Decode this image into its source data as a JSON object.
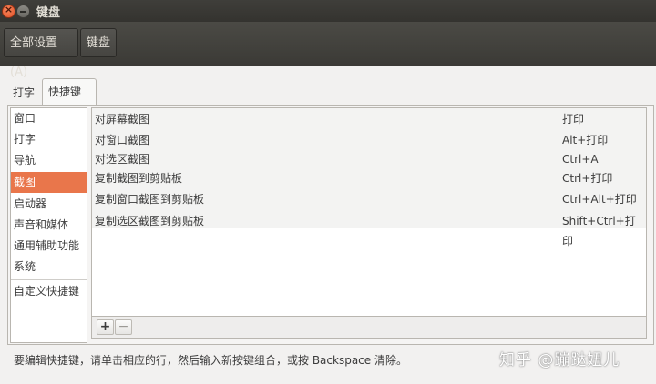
{
  "window": {
    "title": "键盘"
  },
  "breadcrumb": {
    "all_settings": "全部设置(A)",
    "current": "键盘"
  },
  "tabs": [
    {
      "label": "打字"
    },
    {
      "label": "快捷键"
    }
  ],
  "categories": [
    {
      "label": "窗口"
    },
    {
      "label": "打字"
    },
    {
      "label": "导航"
    },
    {
      "label": "截图",
      "selected": true
    },
    {
      "label": "启动器"
    },
    {
      "label": "声音和媒体"
    },
    {
      "label": "通用辅助功能"
    },
    {
      "label": "系统"
    },
    {
      "label": "自定义快捷键"
    }
  ],
  "shortcuts": [
    {
      "action": "对屏幕截图",
      "accel": "打印"
    },
    {
      "action": "对窗口截图",
      "accel": "Alt+打印"
    },
    {
      "action": "对选区截图",
      "accel": "Ctrl+A"
    },
    {
      "action": "复制截图到剪贴板",
      "accel": "Ctrl+打印"
    },
    {
      "action": "复制窗口截图到剪贴板",
      "accel": "Ctrl+Alt+打印"
    },
    {
      "action": "复制选区截图到剪贴板",
      "accel": "Shift+Ctrl+打印"
    }
  ],
  "controls": {
    "add": "+",
    "remove": "−"
  },
  "hint_text": "要编辑快捷键，请单击相应的行，然后输入新按键组合，或按 Backspace 清除。",
  "watermark": "知乎 @蹦跶妞儿",
  "colors": {
    "selection": "#e9764b",
    "titlebar": "#3c3b37"
  }
}
